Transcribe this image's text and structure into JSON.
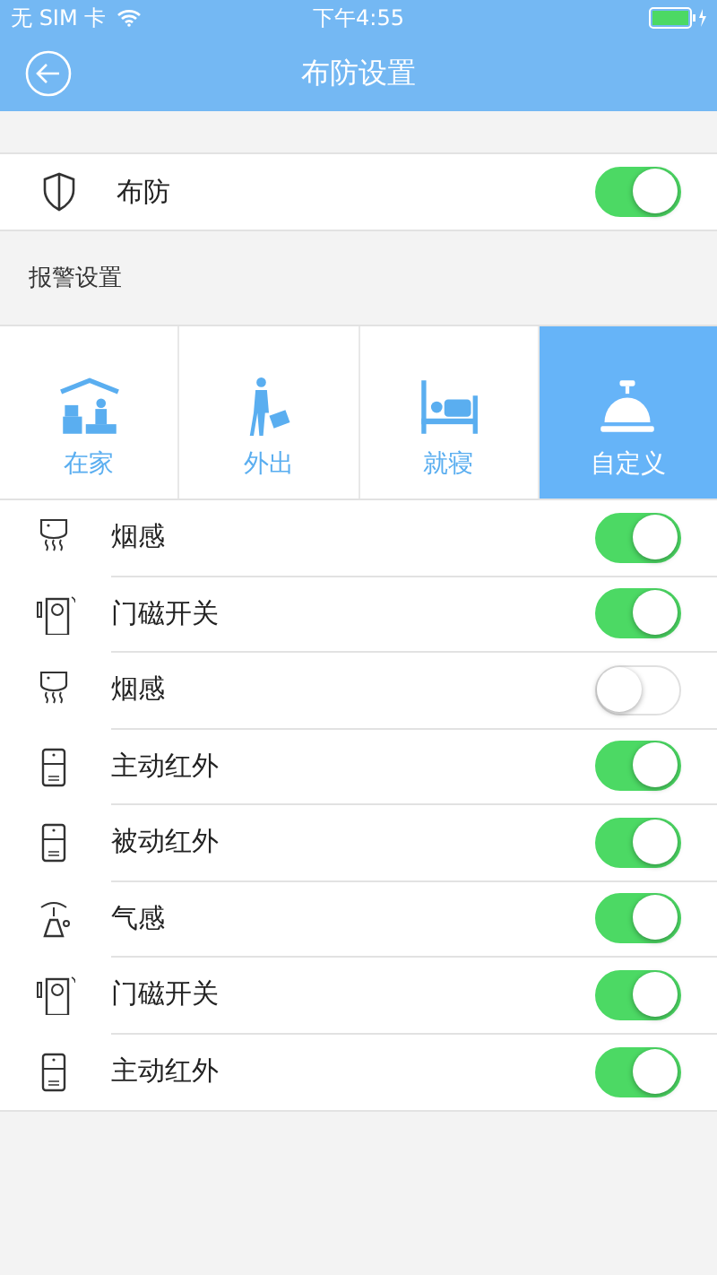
{
  "status_bar": {
    "carrier": "无 SIM 卡",
    "time": "下午4:55"
  },
  "nav": {
    "title": "布防设置"
  },
  "arm": {
    "label": "布防",
    "on": true
  },
  "section_title": "报警设置",
  "modes": [
    {
      "kind": "home",
      "label": "在家",
      "selected": false
    },
    {
      "kind": "away",
      "label": "外出",
      "selected": false
    },
    {
      "kind": "sleep",
      "label": "就寝",
      "selected": false
    },
    {
      "kind": "custom",
      "label": "自定义",
      "selected": true
    }
  ],
  "sensors": [
    {
      "kind": "smoke",
      "name": "烟感",
      "on": true
    },
    {
      "kind": "door",
      "name": "门磁开关",
      "on": true
    },
    {
      "kind": "smoke",
      "name": "烟感",
      "on": false
    },
    {
      "kind": "pir",
      "name": "主动红外",
      "on": true
    },
    {
      "kind": "pir",
      "name": "被动红外",
      "on": true
    },
    {
      "kind": "gas",
      "name": "气感",
      "on": true
    },
    {
      "kind": "door",
      "name": "门磁开关",
      "on": true
    },
    {
      "kind": "pir",
      "name": "主动红外",
      "on": true
    }
  ]
}
